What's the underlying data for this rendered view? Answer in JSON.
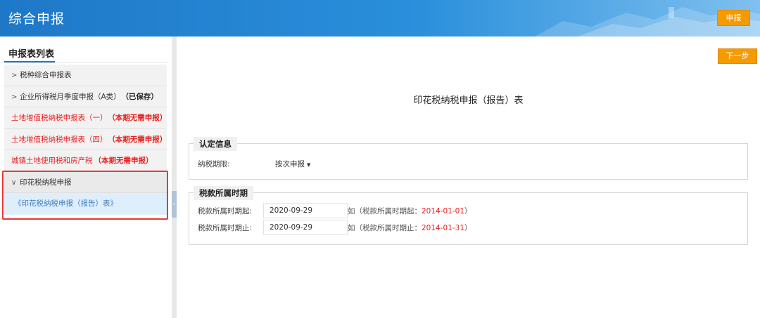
{
  "header": {
    "title": "综合申报",
    "submit_label": "申报"
  },
  "sidebar": {
    "title": "申报表列表",
    "items": [
      {
        "chevron": ">",
        "label": "税种综合申报表",
        "tag": "",
        "style": "dark"
      },
      {
        "chevron": ">",
        "label": "企业所得税月季度申报（A类）",
        "tag": "（已保存）",
        "style": "dark"
      },
      {
        "chevron": "",
        "label": "土地增值税纳税申报表（一）",
        "tag": "（本期无需申报）",
        "style": "red"
      },
      {
        "chevron": "",
        "label": "土地增值税纳税申报表（四）",
        "tag": "（本期无需申报）",
        "style": "red"
      },
      {
        "chevron": "",
        "label": "城镇土地使用税和房产税",
        "tag": "（本期无需申报）",
        "style": "red"
      },
      {
        "chevron": "∨",
        "label": "印花税纳税申报",
        "tag": "",
        "style": "active"
      }
    ],
    "sub_item": "《印花税纳税申报（报告）表》",
    "collapse_glyph": "‹"
  },
  "main": {
    "next_label": "下一步",
    "form_title": "印花税纳税申报（报告）表",
    "section1": {
      "title": "认定信息",
      "period_label": "纳税期限:",
      "period_value": "按次申报",
      "period_arrow": "▼"
    },
    "section2": {
      "title": "税款所属时期",
      "start_label": "税款所属时期起:",
      "start_value": "2020-09-29",
      "start_hint_prefix": "如（税款所属时期起：",
      "start_hint_value": "2014-01-01",
      "start_hint_suffix": "）",
      "end_label": "税款所属时期止:",
      "end_value": "2020-09-29",
      "end_hint_prefix": "如（税款所属时期止：",
      "end_hint_value": "2014-01-31",
      "end_hint_suffix": "）"
    }
  },
  "colors": {
    "header_blue": "#1e78c8",
    "accent_orange": "#f59b00",
    "alert_red": "#e62020",
    "link_blue": "#3d7ec8"
  }
}
